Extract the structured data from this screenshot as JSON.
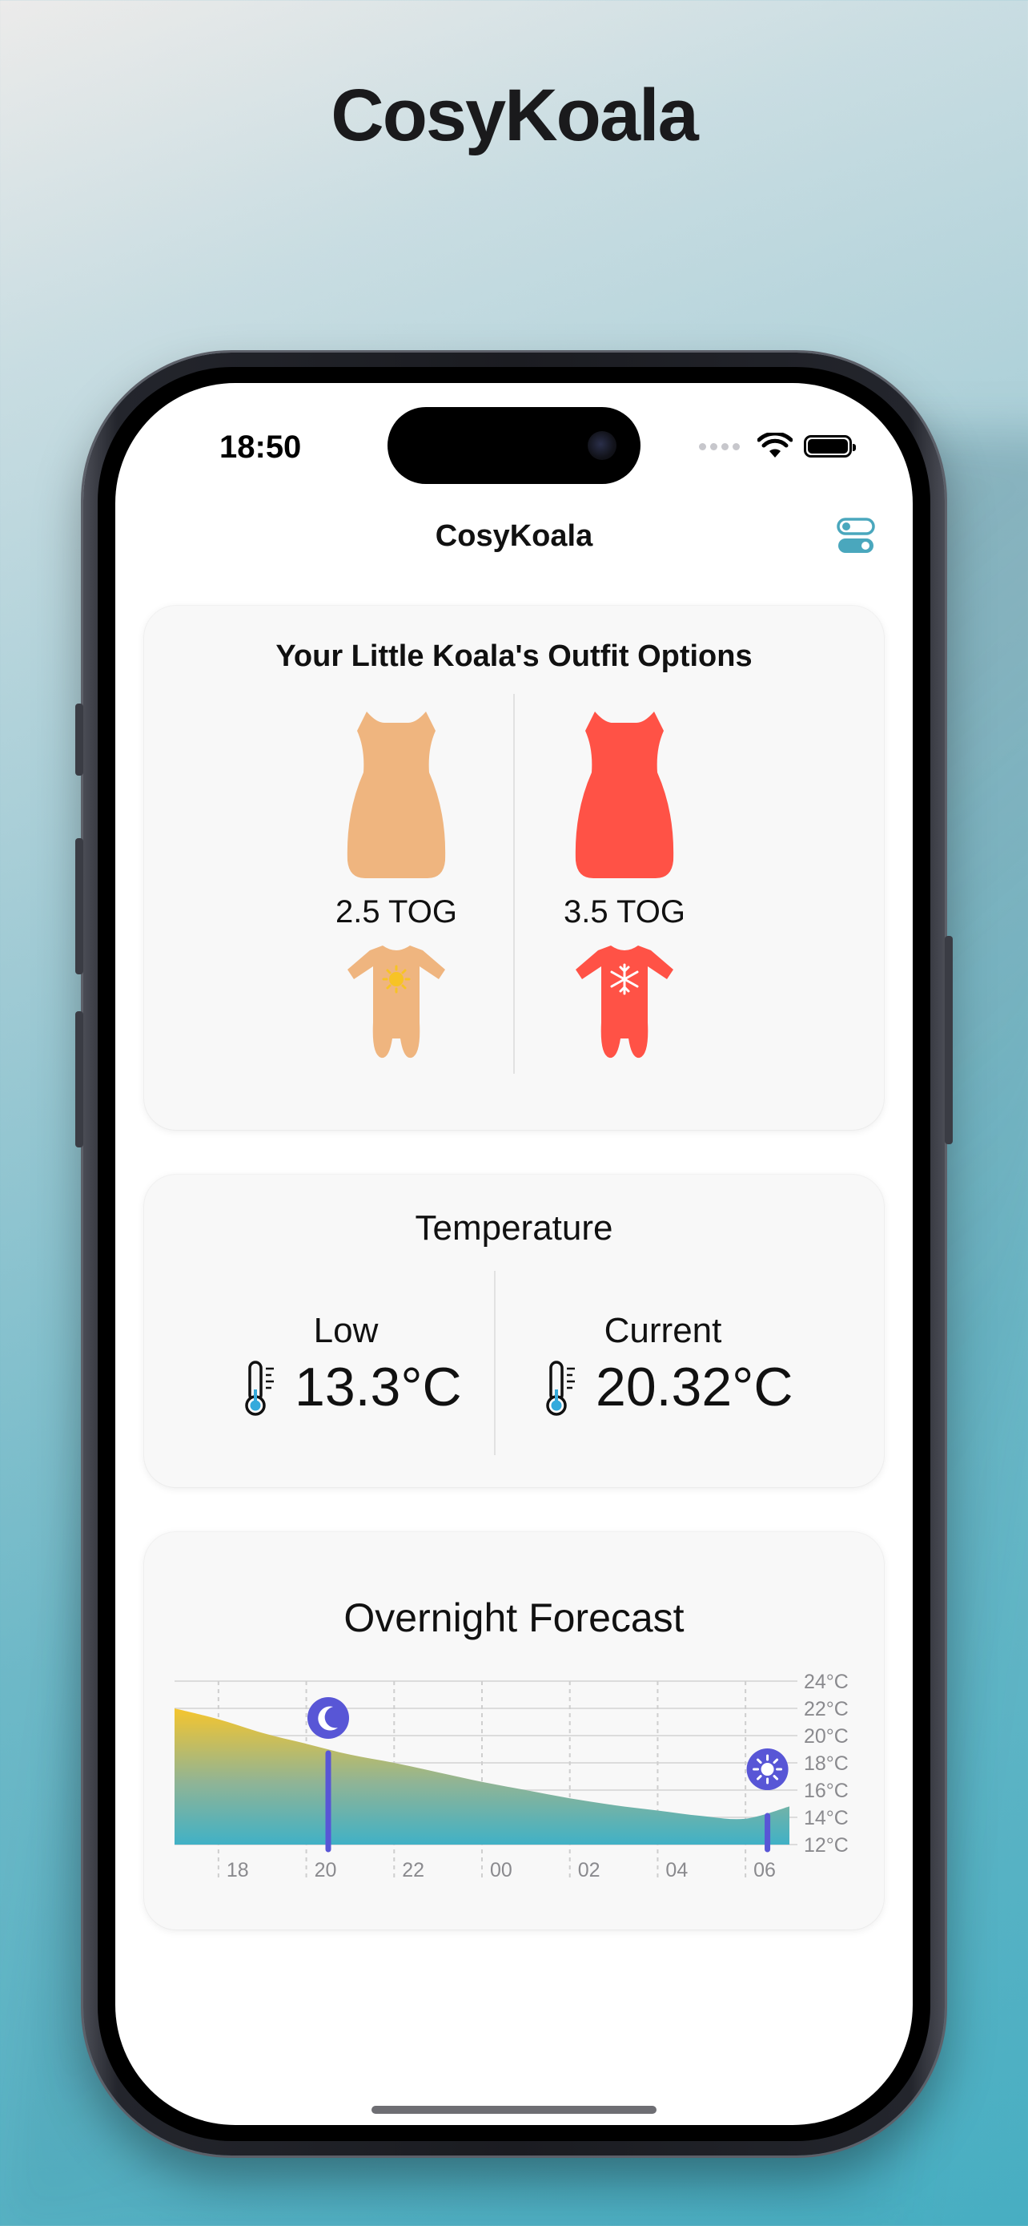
{
  "header": {
    "title": "CosyKoala"
  },
  "status_bar": {
    "time": "18:50"
  },
  "nav": {
    "title": "CosyKoala",
    "settings_icon": "toggle-settings-icon"
  },
  "outfits": {
    "title": "Your Little Koala's Outfit Options",
    "options": [
      {
        "tog": "2.5 TOG",
        "color": "#EFB57F",
        "badge_icon": "sun-icon"
      },
      {
        "tog": "3.5 TOG",
        "color": "#FF5246",
        "badge_icon": "snowflake-icon"
      }
    ]
  },
  "temperature": {
    "title": "Temperature",
    "low": {
      "label": "Low",
      "value": "13.3°C"
    },
    "current": {
      "label": "Current",
      "value": "20.32°C"
    }
  },
  "forecast": {
    "title": "Overnight Forecast"
  },
  "chart_data": {
    "type": "area",
    "x_ticks": [
      "18",
      "20",
      "22",
      "00",
      "02",
      "04",
      "06"
    ],
    "y_ticks": [
      "24°C",
      "22°C",
      "20°C",
      "18°C",
      "16°C",
      "14°C",
      "12°C"
    ],
    "ylim": [
      12,
      24
    ],
    "x": [
      "17:00",
      "18:00",
      "19:00",
      "20:00",
      "21:00",
      "22:00",
      "23:00",
      "00:00",
      "01:00",
      "02:00",
      "03:00",
      "04:00",
      "05:00",
      "06:00",
      "07:00"
    ],
    "values": [
      22.0,
      21.2,
      20.2,
      19.4,
      18.6,
      18.0,
      17.3,
      16.6,
      16.0,
      15.4,
      14.9,
      14.5,
      14.1,
      13.9,
      14.8
    ],
    "bedtime": {
      "time": "20:30",
      "icon": "moon-icon"
    },
    "wake_time": {
      "time": "06:30",
      "icon": "sun-icon"
    },
    "colors": {
      "top": "#F5C52E",
      "bottom": "#40B1C6",
      "markers": "#5856D6"
    },
    "grid": true
  }
}
